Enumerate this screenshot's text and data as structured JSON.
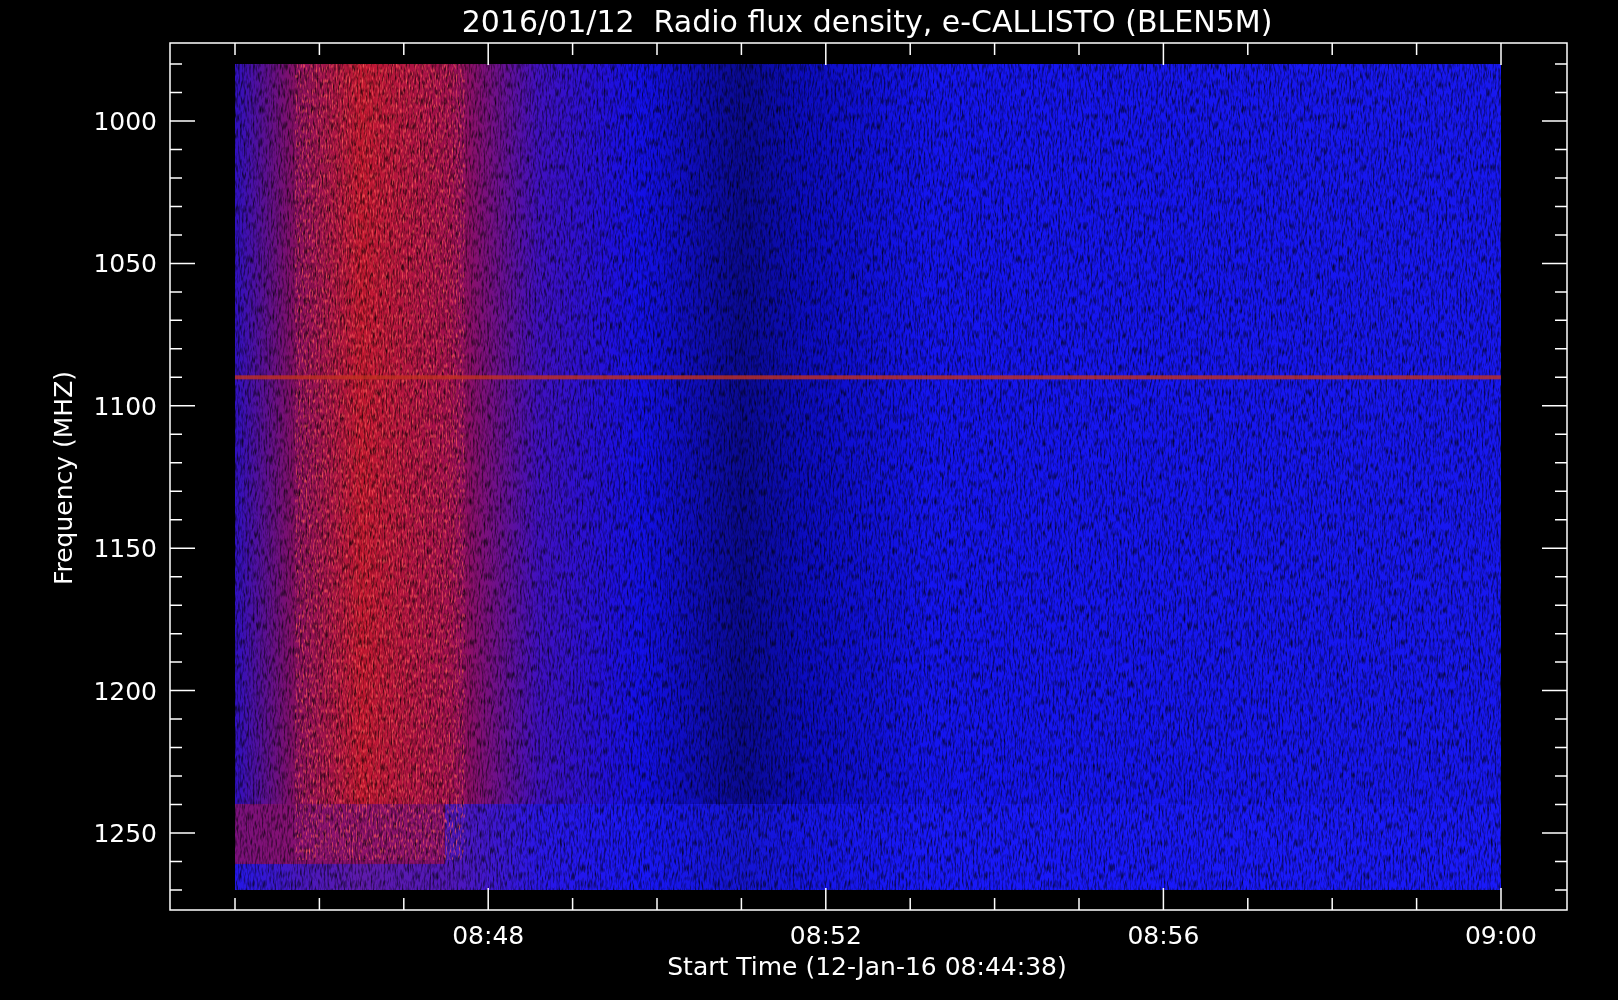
{
  "title": "2016/01/12  Radio flux density, e-CALLISTO (BLEN5M)",
  "chart": {
    "ylabel": "Frequency (MHZ)",
    "xlabel": "Start Time (12-Jan-16 08:44:38)",
    "yticks": [
      "1000",
      "1050",
      "1100",
      "1150",
      "1200",
      "1250"
    ],
    "xticks": [
      "08:48",
      "08:52",
      "08:56",
      "09:00"
    ]
  }
}
